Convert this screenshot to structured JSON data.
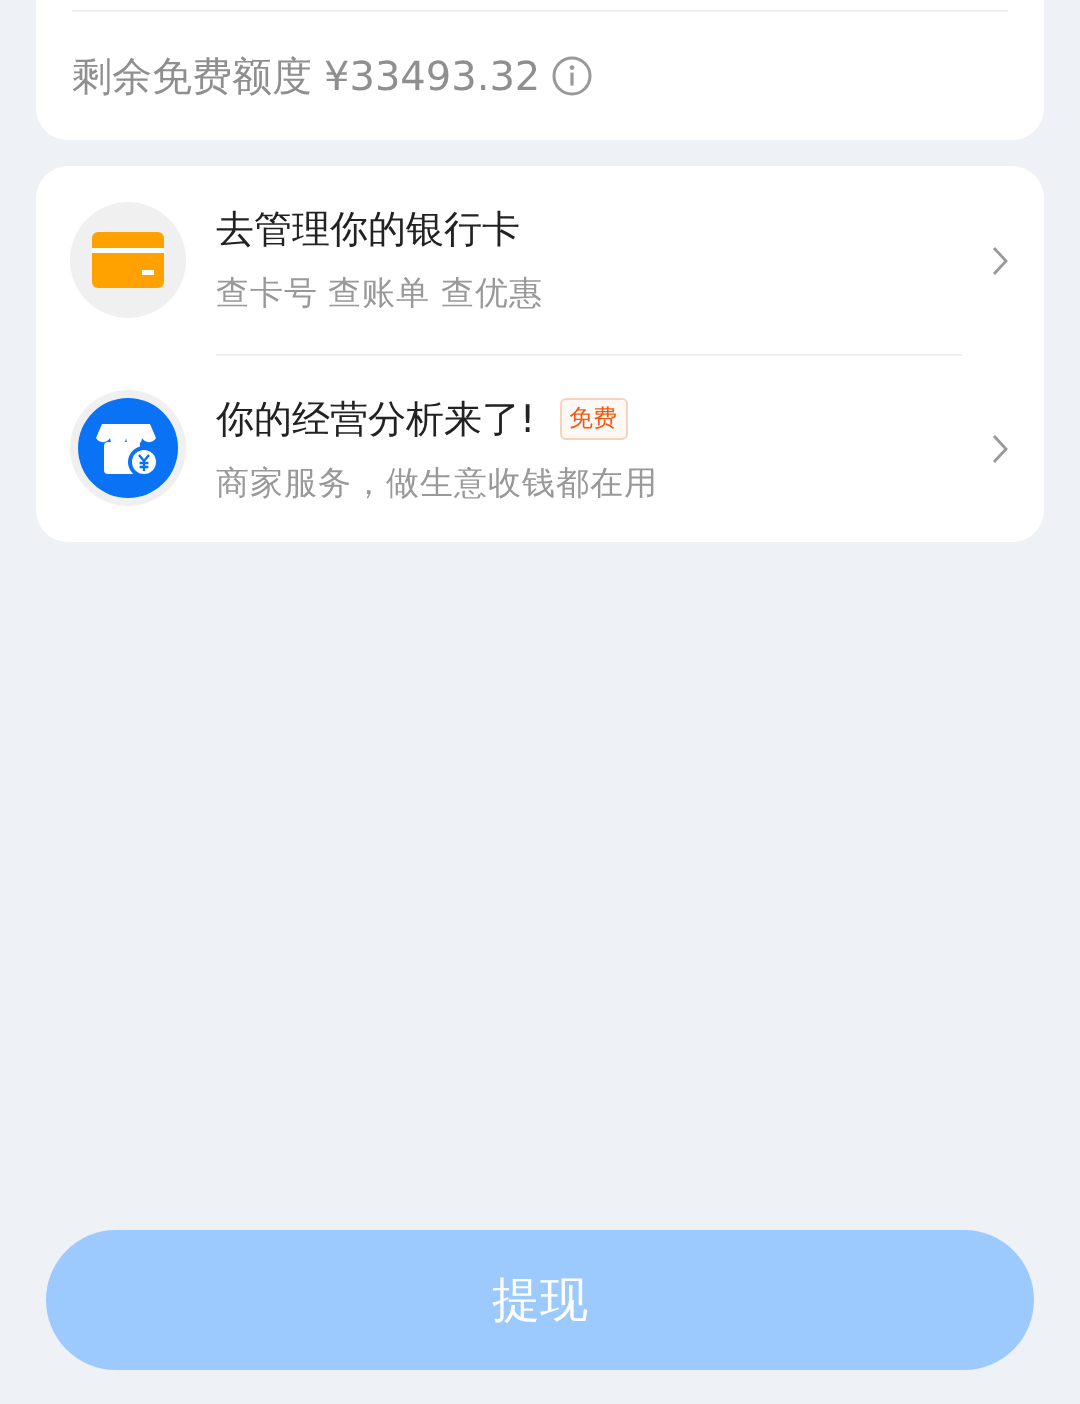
{
  "quota": {
    "label": "剩余免费额度",
    "amount": "¥33493.32"
  },
  "services": [
    {
      "kind": "card",
      "title": "去管理你的银行卡",
      "subtitle": "查卡号 查账单 查优惠"
    },
    {
      "kind": "shop",
      "title": "你的经营分析来了!",
      "badge": "免费",
      "subtitle": "商家服务，做生意收钱都在用"
    }
  ],
  "withdraw_button": {
    "label": "提现",
    "disabled": true
  }
}
